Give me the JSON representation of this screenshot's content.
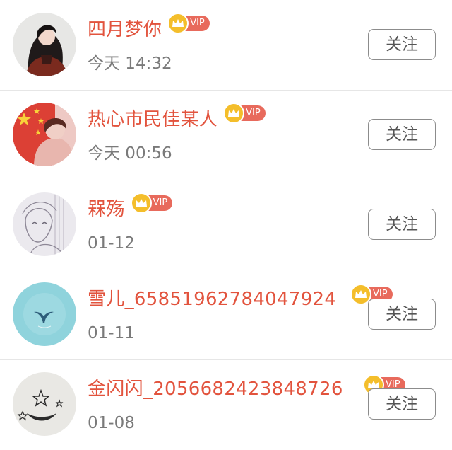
{
  "follow_list": [
    {
      "name": "四月梦你",
      "badge": "VIP",
      "time": "今天 14:32",
      "follow_label": "关注",
      "avatar": "girl-portrait-avatar"
    },
    {
      "name": "热心市民佳某人",
      "badge": "VIP",
      "time": "今天 00:56",
      "follow_label": "关注",
      "avatar": "flag-portrait-avatar"
    },
    {
      "name": "槑殇",
      "badge": "VIP",
      "time": "01-12",
      "follow_label": "关注",
      "avatar": "anime-sketch-avatar"
    },
    {
      "name": "雪儿_65851962784047924",
      "badge": "VIP",
      "time": "01-11",
      "follow_label": "关注",
      "avatar": "whale-tail-avatar"
    },
    {
      "name": "金闪闪_2056682423848726",
      "badge": "VIP",
      "time": "01-08",
      "follow_label": "关注",
      "avatar": "moon-stars-avatar"
    }
  ],
  "colors": {
    "name": "#e2533d",
    "vip_badge": "#e86a5c",
    "crown": "#f4be2b",
    "time": "#7a7a7a",
    "button_border": "#8c8c8c",
    "divider": "#e6e6e6"
  },
  "icons": {
    "vip_crown": "crown-icon"
  }
}
